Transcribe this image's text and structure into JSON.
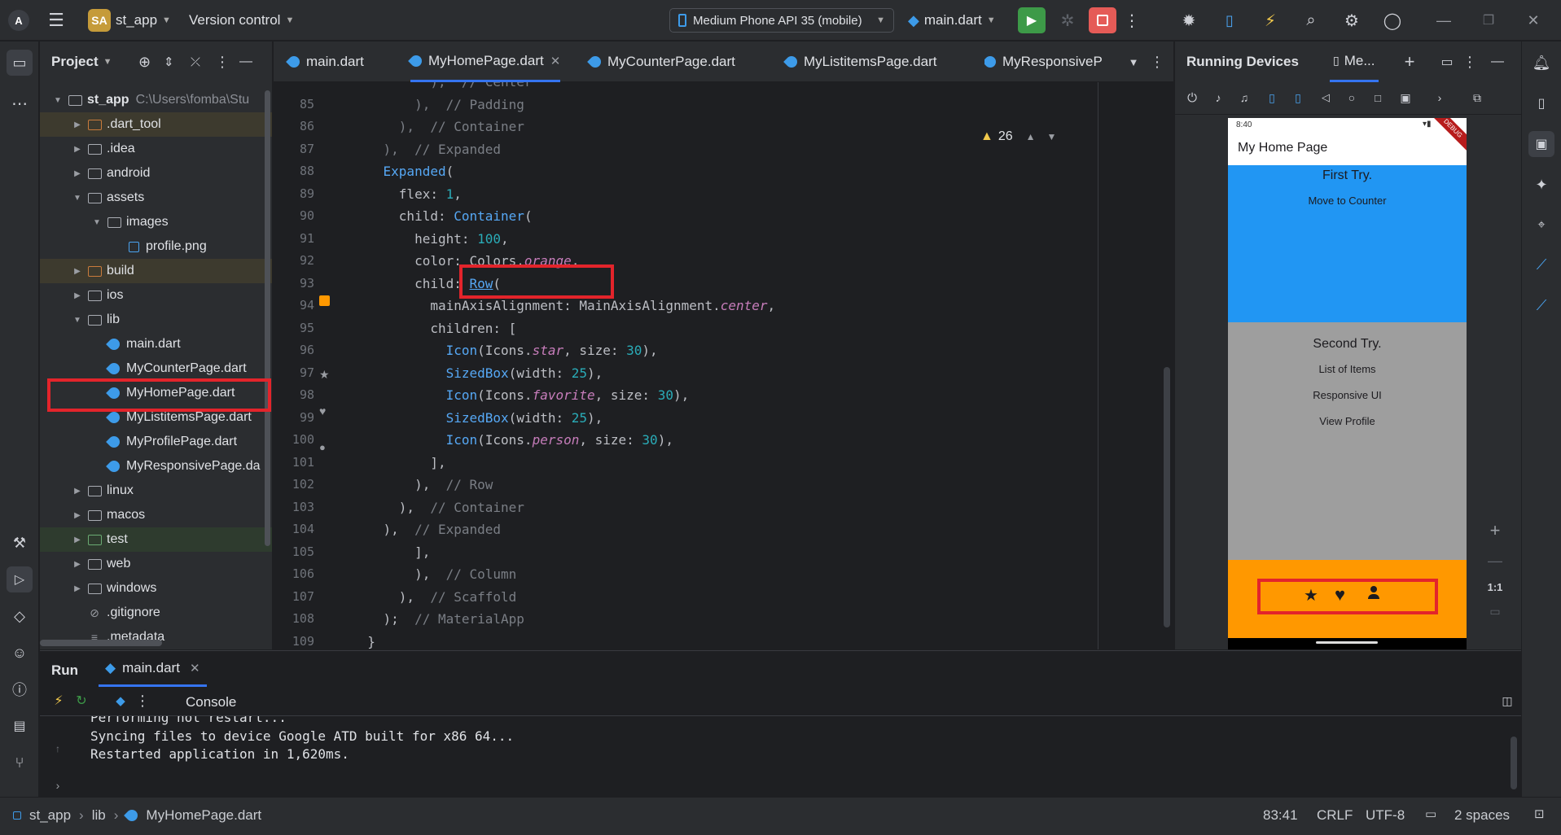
{
  "topbar": {
    "project_badge": "SA",
    "project_name": "st_app",
    "vcs_label": "Version control",
    "device_label": "Medium Phone API 35 (mobile)",
    "run_config": "main.dart"
  },
  "project_panel": {
    "title": "Project",
    "root_name": "st_app",
    "root_path": "C:\\Users\\fomba\\Stu",
    "items": [
      {
        "label": ".dart_tool",
        "kind": "folder-excluded"
      },
      {
        "label": ".idea",
        "kind": "folder"
      },
      {
        "label": "android",
        "kind": "folder"
      },
      {
        "label": "assets",
        "kind": "folder"
      },
      {
        "label": "images",
        "kind": "folder"
      },
      {
        "label": "profile.png",
        "kind": "image"
      },
      {
        "label": "build",
        "kind": "folder-excluded"
      },
      {
        "label": "ios",
        "kind": "folder"
      },
      {
        "label": "lib",
        "kind": "folder"
      },
      {
        "label": "main.dart",
        "kind": "dart"
      },
      {
        "label": "MyCounterPage.dart",
        "kind": "dart"
      },
      {
        "label": "MyHomePage.dart",
        "kind": "dart"
      },
      {
        "label": "MyListitemsPage.dart",
        "kind": "dart"
      },
      {
        "label": "MyProfilePage.dart",
        "kind": "dart"
      },
      {
        "label": "MyResponsivePage.da",
        "kind": "dart"
      },
      {
        "label": "linux",
        "kind": "folder"
      },
      {
        "label": "macos",
        "kind": "folder"
      },
      {
        "label": "test",
        "kind": "folder-test"
      },
      {
        "label": "web",
        "kind": "folder"
      },
      {
        "label": "windows",
        "kind": "folder"
      },
      {
        "label": ".gitignore",
        "kind": "ignore"
      },
      {
        "label": ".metadata",
        "kind": "text"
      }
    ]
  },
  "editor": {
    "tabs": [
      {
        "label": "main.dart"
      },
      {
        "label": "MyHomePage.dart"
      },
      {
        "label": "MyCounterPage.dart"
      },
      {
        "label": "MyListitemsPage.dart"
      },
      {
        "label": "MyResponsiveP"
      }
    ],
    "warning_count": "26",
    "line_numbers": [
      "85",
      "86",
      "87",
      "88",
      "89",
      "90",
      "91",
      "92",
      "93",
      "94",
      "95",
      "96",
      "97",
      "98",
      "99",
      "100",
      "101",
      "102",
      "103",
      "104",
      "105",
      "106",
      "107",
      "108",
      "109"
    ],
    "lines": {
      "l84": "          ),  // Center",
      "l85": "        ),  // Padding",
      "l86": "      ),  // Container",
      "l87": "    ),  // Expanded",
      "l88a": "    ",
      "l88b": "Expanded",
      "l88c": "(",
      "l89a": "      flex: ",
      "l89b": "1",
      "l89c": ",",
      "l90a": "      child: ",
      "l90b": "Container",
      "l90c": "(",
      "l91a": "        height: ",
      "l91b": "100",
      "l91c": ",",
      "l92a": "        color: Colors.",
      "l92b": "orange",
      "l92c": ",",
      "l93a": "        child: ",
      "l93b": "Row",
      "l93c": "(",
      "l94a": "          mainAxisAlignment: MainAxisAlignment.",
      "l94b": "center",
      "l94c": ",",
      "l95": "          children: [",
      "l96a": "            ",
      "l96b": "Icon",
      "l96c": "(Icons.",
      "l96d": "star",
      "l96e": ", size: ",
      "l96f": "30",
      "l96g": "),",
      "l97a": "            ",
      "l97b": "SizedBox",
      "l97c": "(width: ",
      "l97d": "25",
      "l97e": "),",
      "l98a": "            ",
      "l98b": "Icon",
      "l98c": "(Icons.",
      "l98d": "favorite",
      "l98e": ", size: ",
      "l98f": "30",
      "l98g": "),",
      "l99a": "            ",
      "l99b": "SizedBox",
      "l99c": "(width: ",
      "l99d": "25",
      "l99e": "),",
      "l100a": "            ",
      "l100b": "Icon",
      "l100c": "(Icons.",
      "l100d": "person",
      "l100e": ", size: ",
      "l100f": "30",
      "l100g": "),",
      "l101": "          ],",
      "l102a": "        ),  ",
      "l102b": "// Row",
      "l103a": "      ),  ",
      "l103b": "// Container",
      "l104a": "    ),  ",
      "l104b": "// Expanded",
      "l105": "  ],",
      "l106a": "),  ",
      "l106b": "// Column",
      "l107a": "),  ",
      "l107b": "// Scaffold",
      "l108a": ");  ",
      "l108b": "// MaterialApp",
      "l109": "}"
    }
  },
  "running_devices": {
    "title": "Running Devices",
    "tab_label": "Me...",
    "zoom_label": "1:1",
    "phone": {
      "time": "8:40",
      "debug_label": "DEBUG",
      "app_title": "My Home Page",
      "first_title": "First Try.",
      "first_button": "Move to Counter",
      "second_title": "Second Try.",
      "buttons": [
        "List of Items",
        "Responsive UI",
        "View Profile"
      ]
    }
  },
  "run_panel": {
    "tab_run": "Run",
    "tab_file": "main.dart",
    "console_label": "Console",
    "log": [
      "Performing hot restart...",
      "Syncing files to device Google ATD built for x86 64...",
      "Restarted application in 1,620ms."
    ]
  },
  "status_bar": {
    "breadcrumb": [
      "st_app",
      "lib",
      "MyHomePage.dart"
    ],
    "position": "83:41",
    "line_sep": "CRLF",
    "encoding": "UTF-8",
    "indent": "2 spaces"
  },
  "colors": {
    "accent": "#3574f0",
    "run_green": "#3d9a48",
    "stop_red": "#e55b57",
    "highlight_red": "#e3242b",
    "phone_blue": "#2196f3",
    "phone_grey": "#9e9e9e",
    "phone_orange": "#ff9800"
  }
}
